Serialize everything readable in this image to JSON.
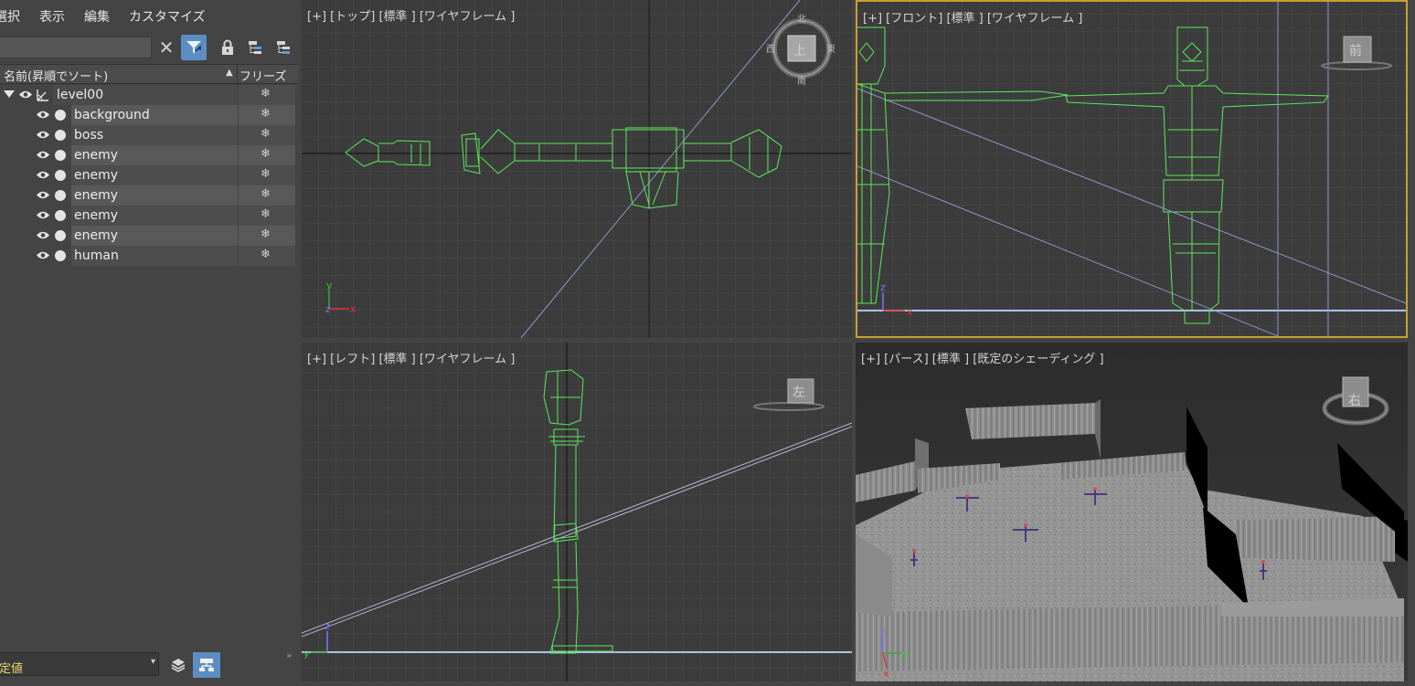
{
  "menu": {
    "items": [
      "選択",
      "表示",
      "編集",
      "カスタマイズ"
    ]
  },
  "toolbar": {
    "search_value": "",
    "clear_glyph": "✕",
    "icons": [
      "clear-icon",
      "filter-icon",
      "lock-icon",
      "hierarchy-icon",
      "hierarchy-alt-icon"
    ]
  },
  "list_header": {
    "name": "名前(昇順でソート)",
    "sort_glyph": "▲",
    "freeze": "フリーズ"
  },
  "tree": {
    "root": {
      "label": "level00"
    },
    "children": [
      {
        "label": "background"
      },
      {
        "label": "boss"
      },
      {
        "label": "enemy"
      },
      {
        "label": "enemy"
      },
      {
        "label": "enemy"
      },
      {
        "label": "enemy"
      },
      {
        "label": "enemy"
      },
      {
        "label": "human"
      }
    ],
    "freeze_glyph": "❄"
  },
  "bottom_bar": {
    "layer_value": "定値",
    "chevron": "»"
  },
  "viewports": {
    "top": {
      "label": "[+] [トップ] [標準 ] [ワイヤフレーム ]",
      "cube_face": "上",
      "compass": {
        "n": "北",
        "s": "南",
        "e": "東",
        "w": "西"
      }
    },
    "front": {
      "label": "[+] [フロント] [標準 ] [ワイヤフレーム ]",
      "cube_face": "前"
    },
    "left": {
      "label": "[+] [レフト] [標準 ] [ワイヤフレーム ]",
      "cube_face": "左"
    },
    "persp": {
      "label": "[+] [パース] [標準 ] [既定のシェーディング ]",
      "cube_face": "右"
    }
  },
  "axis_labels": {
    "x": "x",
    "y": "y",
    "z": "z"
  },
  "colors": {
    "wireframe": "#5be85b",
    "grid_minor": "#4a4a4a",
    "grid_major": "#555555",
    "active_border": "#c8a032",
    "accent_button": "#5b8ec2",
    "camera_line": "#9aa6d6",
    "ground_line": "#a7c3ec"
  }
}
